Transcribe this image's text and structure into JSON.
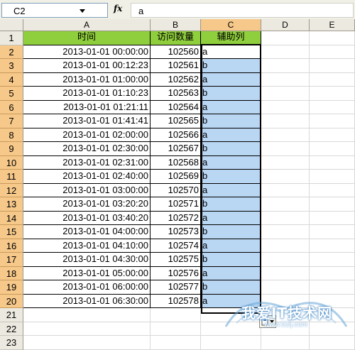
{
  "formula_bar": {
    "name_box": "C2",
    "fx_label": "fx",
    "formula": "a"
  },
  "columns": [
    {
      "id": "col-a",
      "label": "A",
      "active": false
    },
    {
      "id": "col-b",
      "label": "B",
      "active": false
    },
    {
      "id": "col-c",
      "label": "C",
      "active": true
    },
    {
      "id": "col-d",
      "label": "D",
      "active": false
    },
    {
      "id": "col-e",
      "label": "E",
      "active": false
    }
  ],
  "header_row": {
    "a": "时间",
    "b": "访问数量",
    "c": "辅助列"
  },
  "rows": [
    {
      "n": "2",
      "a": "2013-01-01  00:00:00",
      "b": "102560",
      "c": "a"
    },
    {
      "n": "3",
      "a": "2013-01-01  00:12:23",
      "b": "102561",
      "c": "b"
    },
    {
      "n": "4",
      "a": "2013-01-01  01:00:00",
      "b": "102562",
      "c": "a"
    },
    {
      "n": "5",
      "a": "2013-01-01  01:10:23",
      "b": "102563",
      "c": "b"
    },
    {
      "n": "6",
      "a": "2013-01-01  01:21:11",
      "b": "102564",
      "c": "a"
    },
    {
      "n": "7",
      "a": "2013-01-01  01:41:41",
      "b": "102565",
      "c": "b"
    },
    {
      "n": "8",
      "a": "2013-01-01  02:00:00",
      "b": "102566",
      "c": "a"
    },
    {
      "n": "9",
      "a": "2013-01-01  02:30:00",
      "b": "102567",
      "c": "b"
    },
    {
      "n": "10",
      "a": "2013-01-01  02:31:00",
      "b": "102568",
      "c": "a"
    },
    {
      "n": "11",
      "a": "2013-01-01  02:40:00",
      "b": "102569",
      "c": "b"
    },
    {
      "n": "12",
      "a": "2013-01-01  03:00:00",
      "b": "102570",
      "c": "a"
    },
    {
      "n": "13",
      "a": "2013-01-01  03:20:20",
      "b": "102571",
      "c": "b"
    },
    {
      "n": "14",
      "a": "2013-01-01  03:40:20",
      "b": "102572",
      "c": "a"
    },
    {
      "n": "15",
      "a": "2013-01-01  04:00:00",
      "b": "102573",
      "c": "b"
    },
    {
      "n": "16",
      "a": "2013-01-01  04:10:00",
      "b": "102574",
      "c": "a"
    },
    {
      "n": "17",
      "a": "2013-01-01  04:30:00",
      "b": "102575",
      "c": "b"
    },
    {
      "n": "18",
      "a": "2013-01-01  05:00:00",
      "b": "102576",
      "c": "a"
    },
    {
      "n": "19",
      "a": "2013-01-01  06:00:00",
      "b": "102577",
      "c": "b"
    },
    {
      "n": "20",
      "a": "2013-01-01  06:30:00",
      "b": "102578",
      "c": "a"
    }
  ],
  "empty_rows": [
    "21",
    "22",
    "23"
  ],
  "row1_label": "1",
  "watermark": {
    "text": "我爱IT技术网",
    "url": "www.52ij.com"
  },
  "colors": {
    "header_green": "#8fce3c",
    "selection_blue": "#b9d6f3",
    "active_header": "#f6c88a"
  }
}
